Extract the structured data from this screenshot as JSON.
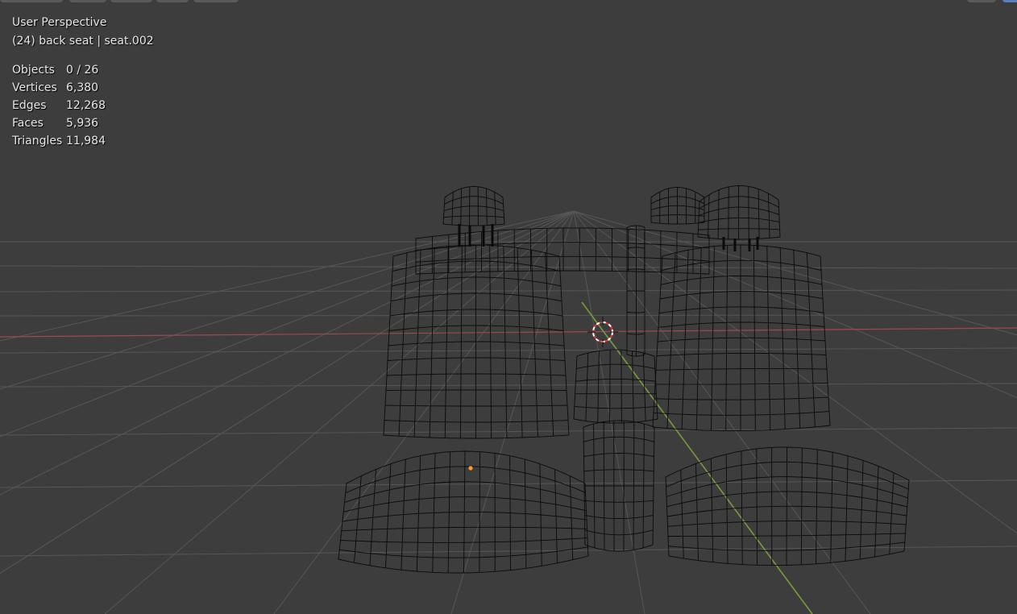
{
  "viewport": {
    "title": "User Perspective",
    "context": "(24) back seat | seat.002"
  },
  "stats": [
    {
      "label": "Objects",
      "value": "0 / 26"
    },
    {
      "label": "Vertices",
      "value": "6,380"
    },
    {
      "label": "Edges",
      "value": "12,268"
    },
    {
      "label": "Faces",
      "value": "5,936"
    },
    {
      "label": "Triangles",
      "value": "11,984"
    }
  ],
  "colors": {
    "background": "#3d3d3d",
    "grid": "#575757",
    "x_axis": "#9c4a52",
    "y_axis": "#7a9a3c",
    "wire": "#0a0a0a",
    "origin": "#ff9a2a",
    "cursor_red": "#d83a3a",
    "cursor_white": "#ffffff",
    "accent_button": "#5680c2"
  }
}
